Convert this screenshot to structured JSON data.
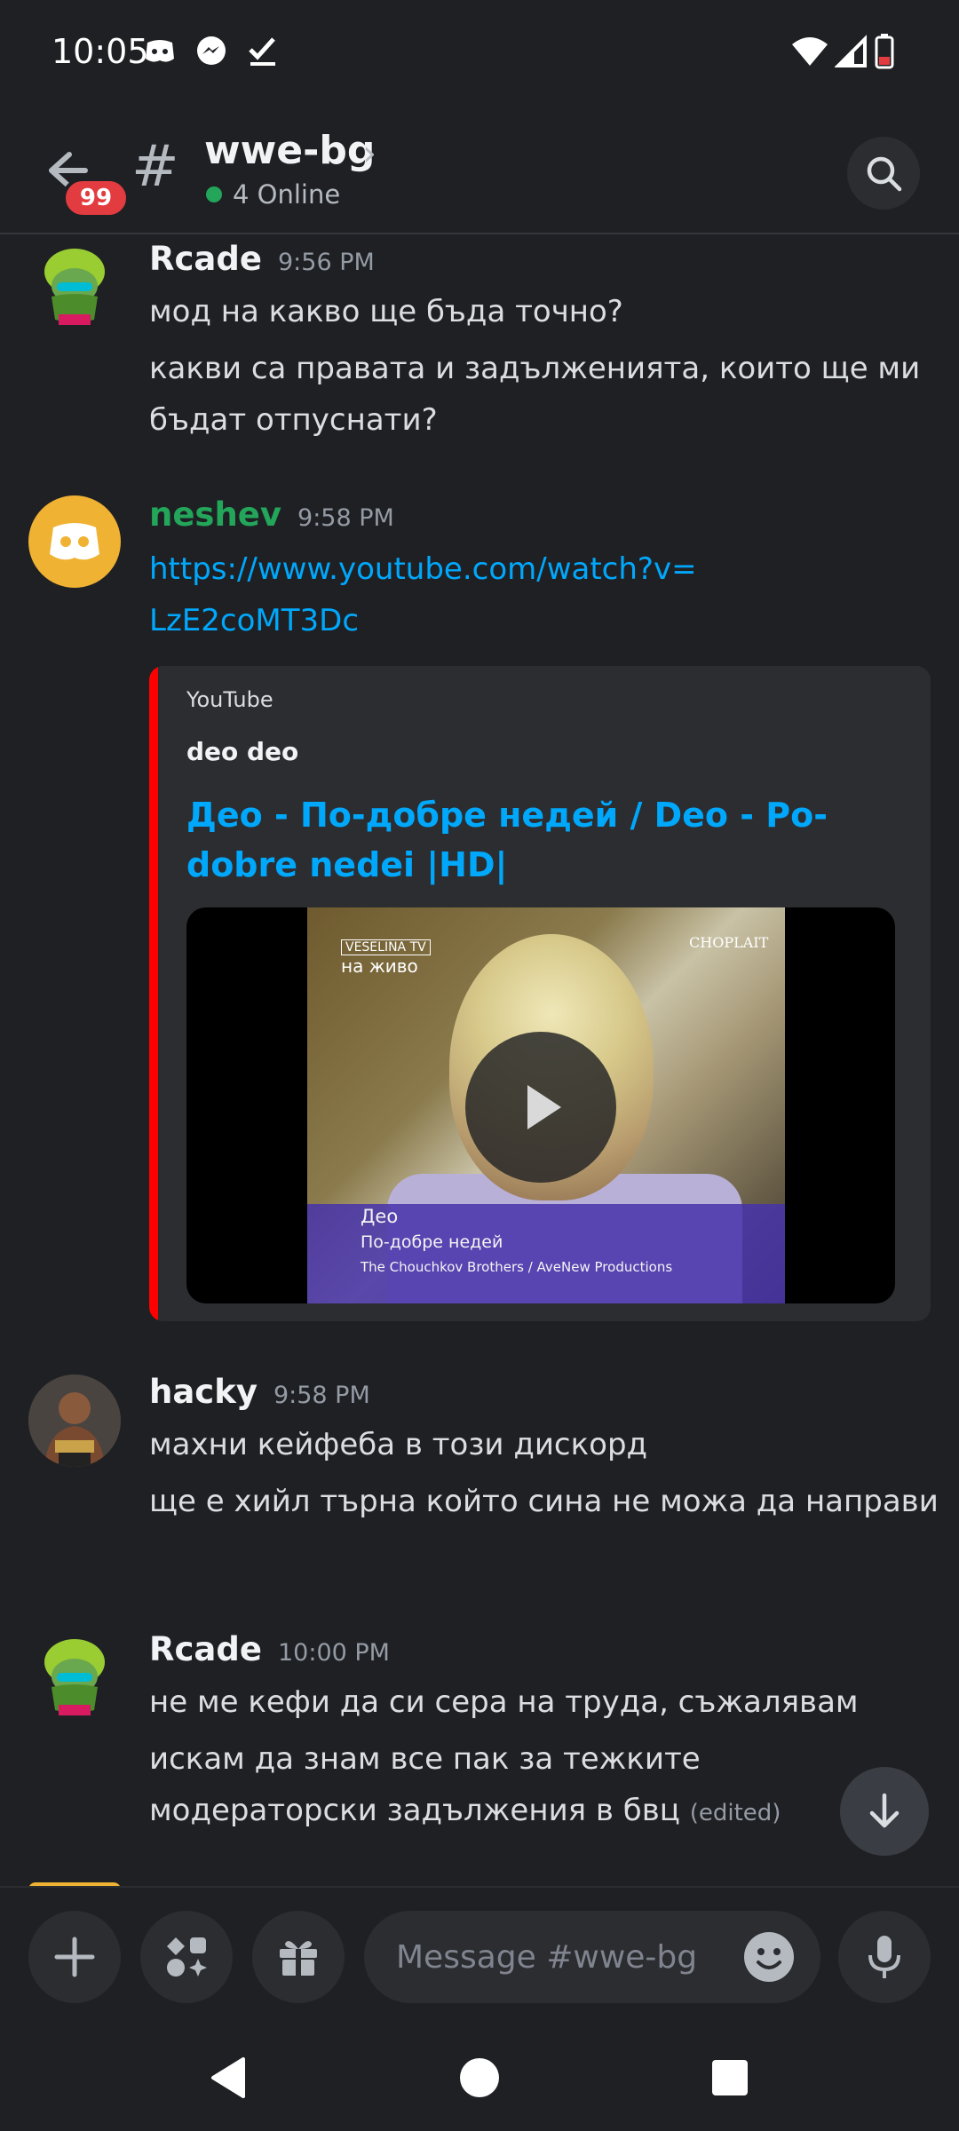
{
  "status_bar": {
    "time": "10:05"
  },
  "header": {
    "badge_count": "99",
    "channel_name": "wwe-bg",
    "online_text": "4 Online"
  },
  "messages": [
    {
      "author": "Rcade",
      "author_color": "#f2f3f5",
      "time": "9:56 PM",
      "lines": [
        "мод на какво ще бъда точно?",
        "какви са правата и задълженията, които ще ми бъдат отпуснати?"
      ]
    },
    {
      "author": "neshev",
      "author_color": "#23a55a",
      "time": "9:58 PM",
      "link_line1": "https://www.youtube.com/watch?v=",
      "link_line2": "LzE2coMT3Dc",
      "embed": {
        "provider": "YouTube",
        "author": "deo deo",
        "title": "Део - По-добре недей / Deo - Po-dobre nedei |HD|",
        "video_overlay": {
          "channel": "VESELINA TV",
          "live": "на живо",
          "watermark": "CHOPLAIT",
          "line1": "Део",
          "line2": "По-добре недей",
          "line3": "The Chouchkov Brothers / AveNew Productions"
        }
      }
    },
    {
      "author": "hacky",
      "author_color": "#f2f3f5",
      "time": "9:58 PM",
      "lines": [
        "махни кейфеба в този дискорд",
        "ще е хийл търна който сина не можа да направи"
      ]
    },
    {
      "author": "Rcade",
      "author_color": "#f2f3f5",
      "time": "10:00 PM",
      "lines": [
        "не ме кефи да си сера на труда, съжалявам",
        "искам да знам все пак за тежките модераторски задължения в бвц"
      ],
      "edited_label": "(edited)"
    }
  ],
  "composer": {
    "placeholder": "Message #wwe-bg"
  },
  "colors": {
    "accent_link": "#00a8fc",
    "online": "#23a55a",
    "badge": "#e23c40",
    "embed_bar": "#ff0000"
  }
}
